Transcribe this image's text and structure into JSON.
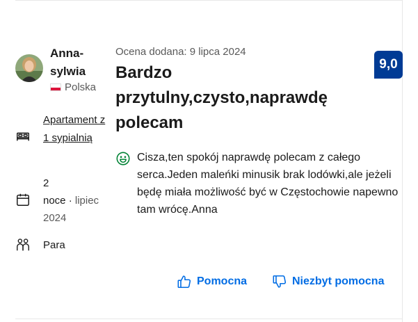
{
  "review": {
    "author": {
      "name": "Anna-sylwia",
      "country": "Polska"
    },
    "room_type": "Apartament z 1 sypialnią",
    "stay": {
      "nights_number": "2",
      "nights_label": "noce",
      "separator": "·",
      "month": "lipiec",
      "year": "2024"
    },
    "traveler_type": "Para",
    "date_added": "Ocena dodana: 9 lipca 2024",
    "title": "Bardzo przytulny,czysto,naprawdę polecam",
    "score": "9,0",
    "positive_text": "Cisza,ten spokój naprawdę polecam z całego serca.Jeden maleńki minusik brak lodówki,ale jeżeli będę miała możliwość być w Częstochowie napewno tam wrócę.Anna"
  },
  "actions": {
    "helpful_label": "Pomocna",
    "not_helpful_label": "Niezbyt pomocna"
  },
  "colors": {
    "accent": "#006ce4",
    "score_bg": "#003b95",
    "positive": "#008234",
    "flag_red": "#dc143c"
  },
  "icons": [
    "bed-icon",
    "calendar-icon",
    "people-icon",
    "smile-icon",
    "thumbs-up-icon",
    "thumbs-down-icon"
  ]
}
